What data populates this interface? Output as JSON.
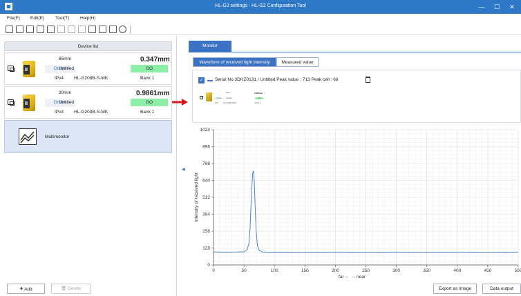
{
  "window": {
    "title": "HL-G2 settings - HL-G2 Configuration Tool",
    "minimize": "—",
    "maximize": "☐",
    "close": "✕"
  },
  "menu": {
    "items": [
      "File(F)",
      "Edit(E)",
      "Tool(T)",
      "Help(H)"
    ]
  },
  "toolbar": {
    "icons": [
      "new-file-icon",
      "open-folder-icon",
      "save-icon",
      "import-icon",
      "export-icon",
      "copy-icon",
      "paste-icon",
      "duplicate-icon",
      "compare-icon",
      "verify-icon",
      "book-icon",
      "info-icon"
    ]
  },
  "sidebar": {
    "header": "Device list",
    "devices": [
      {
        "range": "85mm",
        "measurement": "0.347mm",
        "status": "Online",
        "name": "Untitled",
        "go": "GO",
        "protocol": "IPv4",
        "model": "HL-G208B-S-MK",
        "bank": "Bank 1"
      },
      {
        "range": "30mm",
        "measurement": "0.9861mm",
        "status": "Online",
        "name": "Untitled",
        "go": "GO",
        "protocol": "IPv4",
        "model": "HL-G203B-S-MK",
        "bank": "Bank 1"
      }
    ],
    "multimonitor_label": "Multimonitor",
    "add_label": "Add",
    "delete_label": "Delete"
  },
  "main": {
    "tab_monitor": "Monitor",
    "subtab_waveform": "Waveform of received light intensity",
    "subtab_measured": "Measured value",
    "serial_line": "Serial No.3DHZ0131 / Untitled Peak value :   713 Peak cell :     66",
    "mini_card": {
      "range": "30mm",
      "measurement": "0.9861mm",
      "status": "Online",
      "name": "Untitled",
      "go": "GO",
      "protocol": "IPv4",
      "model": "HL-G203B-S-MK",
      "bank": "Bank 1"
    },
    "export_label": "Export as Image",
    "data_output_label": "Data output"
  },
  "colors": {
    "accent": "#3b73c4",
    "go_green": "#8ef0a8",
    "line_color": "#4a84c9",
    "arrow_red": "#e0151b"
  },
  "chart_data": {
    "type": "line",
    "xlabel": "far ← → near",
    "ylabel": "Intensity of received light",
    "xlim": [
      0,
      500
    ],
    "ylim": [
      0,
      1024
    ],
    "x_ticks": [
      0,
      50,
      100,
      150,
      200,
      250,
      300,
      350,
      400,
      450,
      500
    ],
    "y_ticks": [
      0,
      128,
      256,
      384,
      512,
      640,
      768,
      896,
      1024
    ],
    "grid": true,
    "series": [
      {
        "x": [
          0,
          20,
          40,
          50,
          55,
          58,
          60,
          62,
          64,
          65,
          66,
          67,
          68,
          70,
          72,
          75,
          80,
          90,
          100,
          150,
          200,
          250,
          300,
          350,
          400,
          450,
          500
        ],
        "values": [
          98,
          97,
          98,
          100,
          115,
          160,
          280,
          500,
          680,
          713,
          700,
          620,
          480,
          260,
          150,
          110,
          98,
          96,
          97,
          96,
          97,
          96,
          97,
          96,
          97,
          96,
          97
        ]
      }
    ]
  }
}
